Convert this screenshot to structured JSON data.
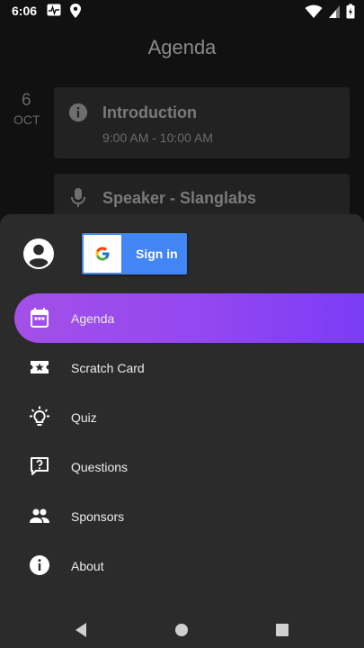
{
  "status_bar": {
    "time": "6:06"
  },
  "background": {
    "title": "Agenda",
    "date": {
      "day": "6",
      "month": "OCT"
    },
    "cards": [
      {
        "title": "Introduction",
        "time": "9:00 AM - 10:00 AM",
        "icon": "info-icon"
      },
      {
        "title": "Speaker - Slanglabs",
        "icon": "mic-icon"
      }
    ]
  },
  "drawer": {
    "sign_in_label": "Sign in",
    "items": [
      {
        "label": "Agenda",
        "icon": "calendar-icon",
        "active": true
      },
      {
        "label": "Scratch Card",
        "icon": "ticket-star-icon"
      },
      {
        "label": "Quiz",
        "icon": "lightbulb-icon"
      },
      {
        "label": "Questions",
        "icon": "question-bubble-icon"
      },
      {
        "label": "Sponsors",
        "icon": "people-icon"
      },
      {
        "label": "About",
        "icon": "info-icon"
      }
    ]
  },
  "colors": {
    "accent_start": "#a350e8",
    "accent_end": "#7b3cf6",
    "google_blue": "#4285f4"
  }
}
